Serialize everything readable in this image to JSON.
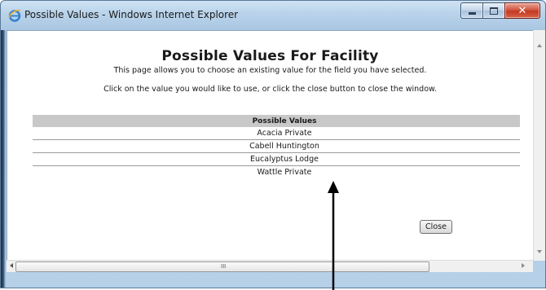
{
  "window": {
    "title": "Possible Values - Windows Internet Explorer",
    "app_icon": "internet-explorer-icon",
    "controls": {
      "minimize_icon": "minimize-icon",
      "maximize_icon": "maximize-icon",
      "close_icon": "close-icon"
    }
  },
  "page": {
    "title": "Possible Values For Facility",
    "intro": "This page allows you to choose an existing value for the field you have selected.",
    "instruction": "Click on the value you would like to use, or click the close button to close the window."
  },
  "table": {
    "header": "Possible Values",
    "rows": [
      "Acacia Private",
      "Cabell Huntington",
      "Eucalyptus Lodge",
      "Wattle Private"
    ]
  },
  "close_button": {
    "label": "Close"
  },
  "scrollbar": {
    "grip": "III"
  },
  "colors": {
    "header_bg": "#c8c8c8",
    "annotation_arrow": "#000000",
    "titlebar": "#b9d3ea"
  }
}
